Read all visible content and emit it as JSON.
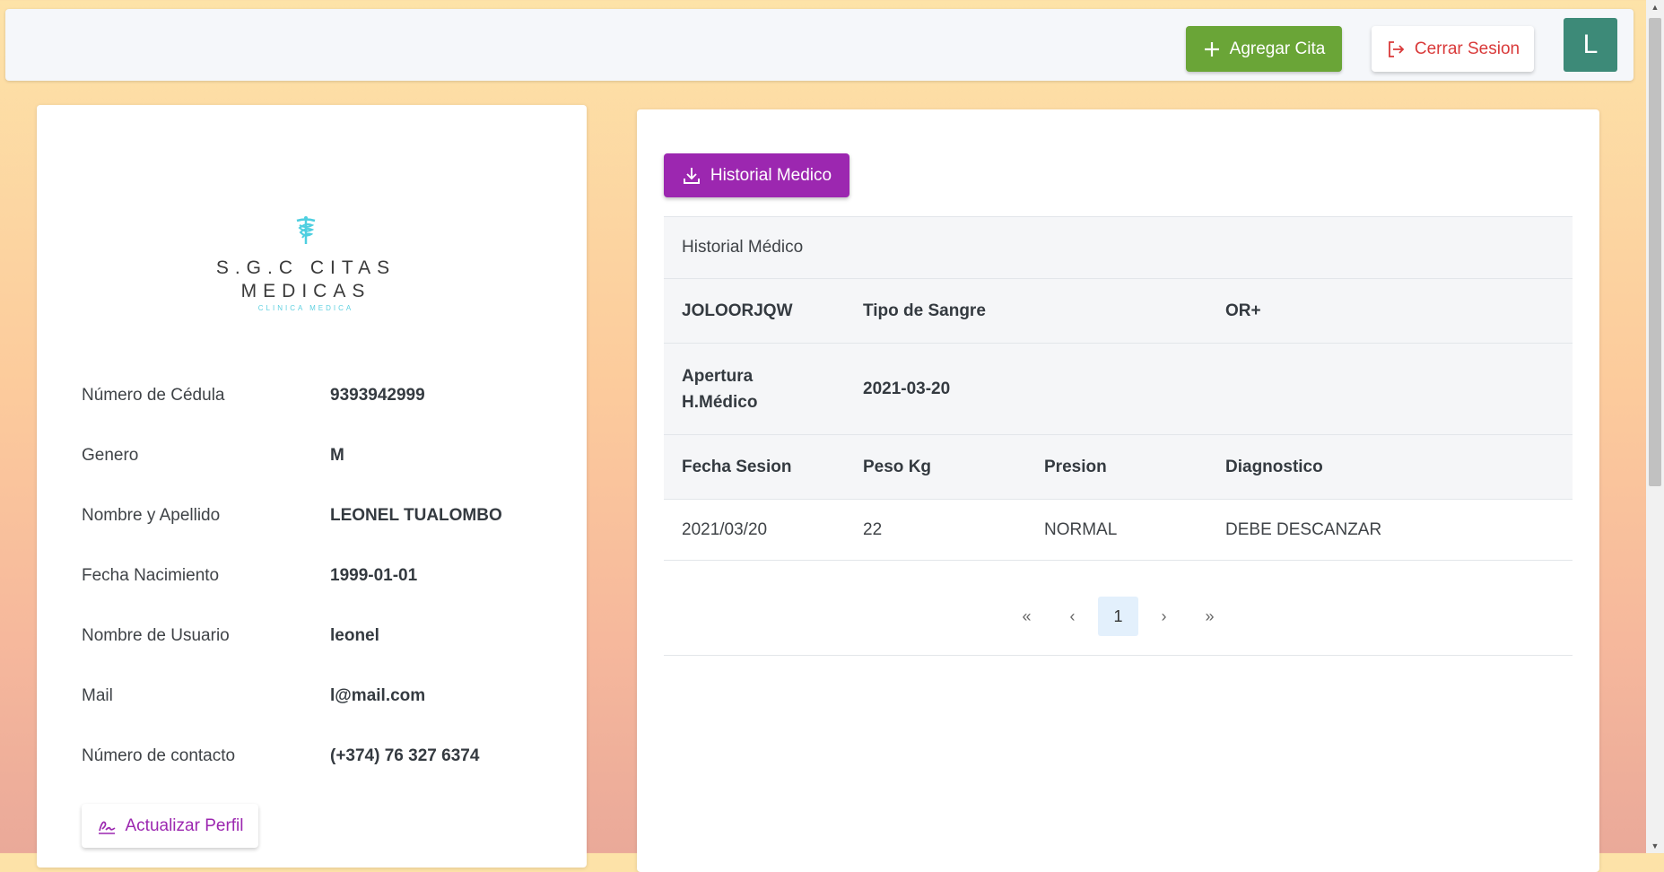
{
  "header": {
    "add_appointment_label": "Agregar Cita",
    "logout_label": "Cerrar Sesion",
    "avatar_initial": "L"
  },
  "logo": {
    "line1": "S.G.C CITAS",
    "line2": "MEDICAS",
    "line3": "CLINICA MEDICA",
    "color": "#4ecfe0"
  },
  "profile": {
    "fields": [
      {
        "label": "Número de Cédula",
        "value": "9393942999"
      },
      {
        "label": "Genero",
        "value": "M"
      },
      {
        "label": "Nombre y Apellido",
        "value": "LEONEL TUALOMBO"
      },
      {
        "label": "Fecha Nacimiento",
        "value": "1999-01-01"
      },
      {
        "label": "Nombre de Usuario",
        "value": "leonel"
      },
      {
        "label": "Mail",
        "value": "l@mail.com"
      },
      {
        "label": "Número de contacto",
        "value": "(+374) 76 327 6374"
      }
    ],
    "update_label": "Actualizar Perfil"
  },
  "history": {
    "download_label": "Historial Medico",
    "title": "Historial Médico",
    "code": "JOLOORJQW",
    "blood_type_label": "Tipo de Sangre",
    "blood_type": "OR+",
    "opening_label_1": "Apertura",
    "opening_label_2": "H.Médico",
    "opening_date": "2021-03-20",
    "columns": [
      "Fecha Sesion",
      "Peso Kg",
      "Presion",
      "Diagnostico"
    ],
    "rows": [
      [
        "2021/03/20",
        "22",
        "NORMAL",
        "DEBE DESCANZAR"
      ]
    ],
    "pagination": {
      "first": "«",
      "prev": "‹",
      "current": "1",
      "next": "›",
      "last": "»"
    }
  },
  "colors": {
    "add_button": "#6aa537",
    "logout_text": "#d93a3a",
    "avatar": "#3d8a78",
    "accent_purple": "#9c27b0"
  }
}
